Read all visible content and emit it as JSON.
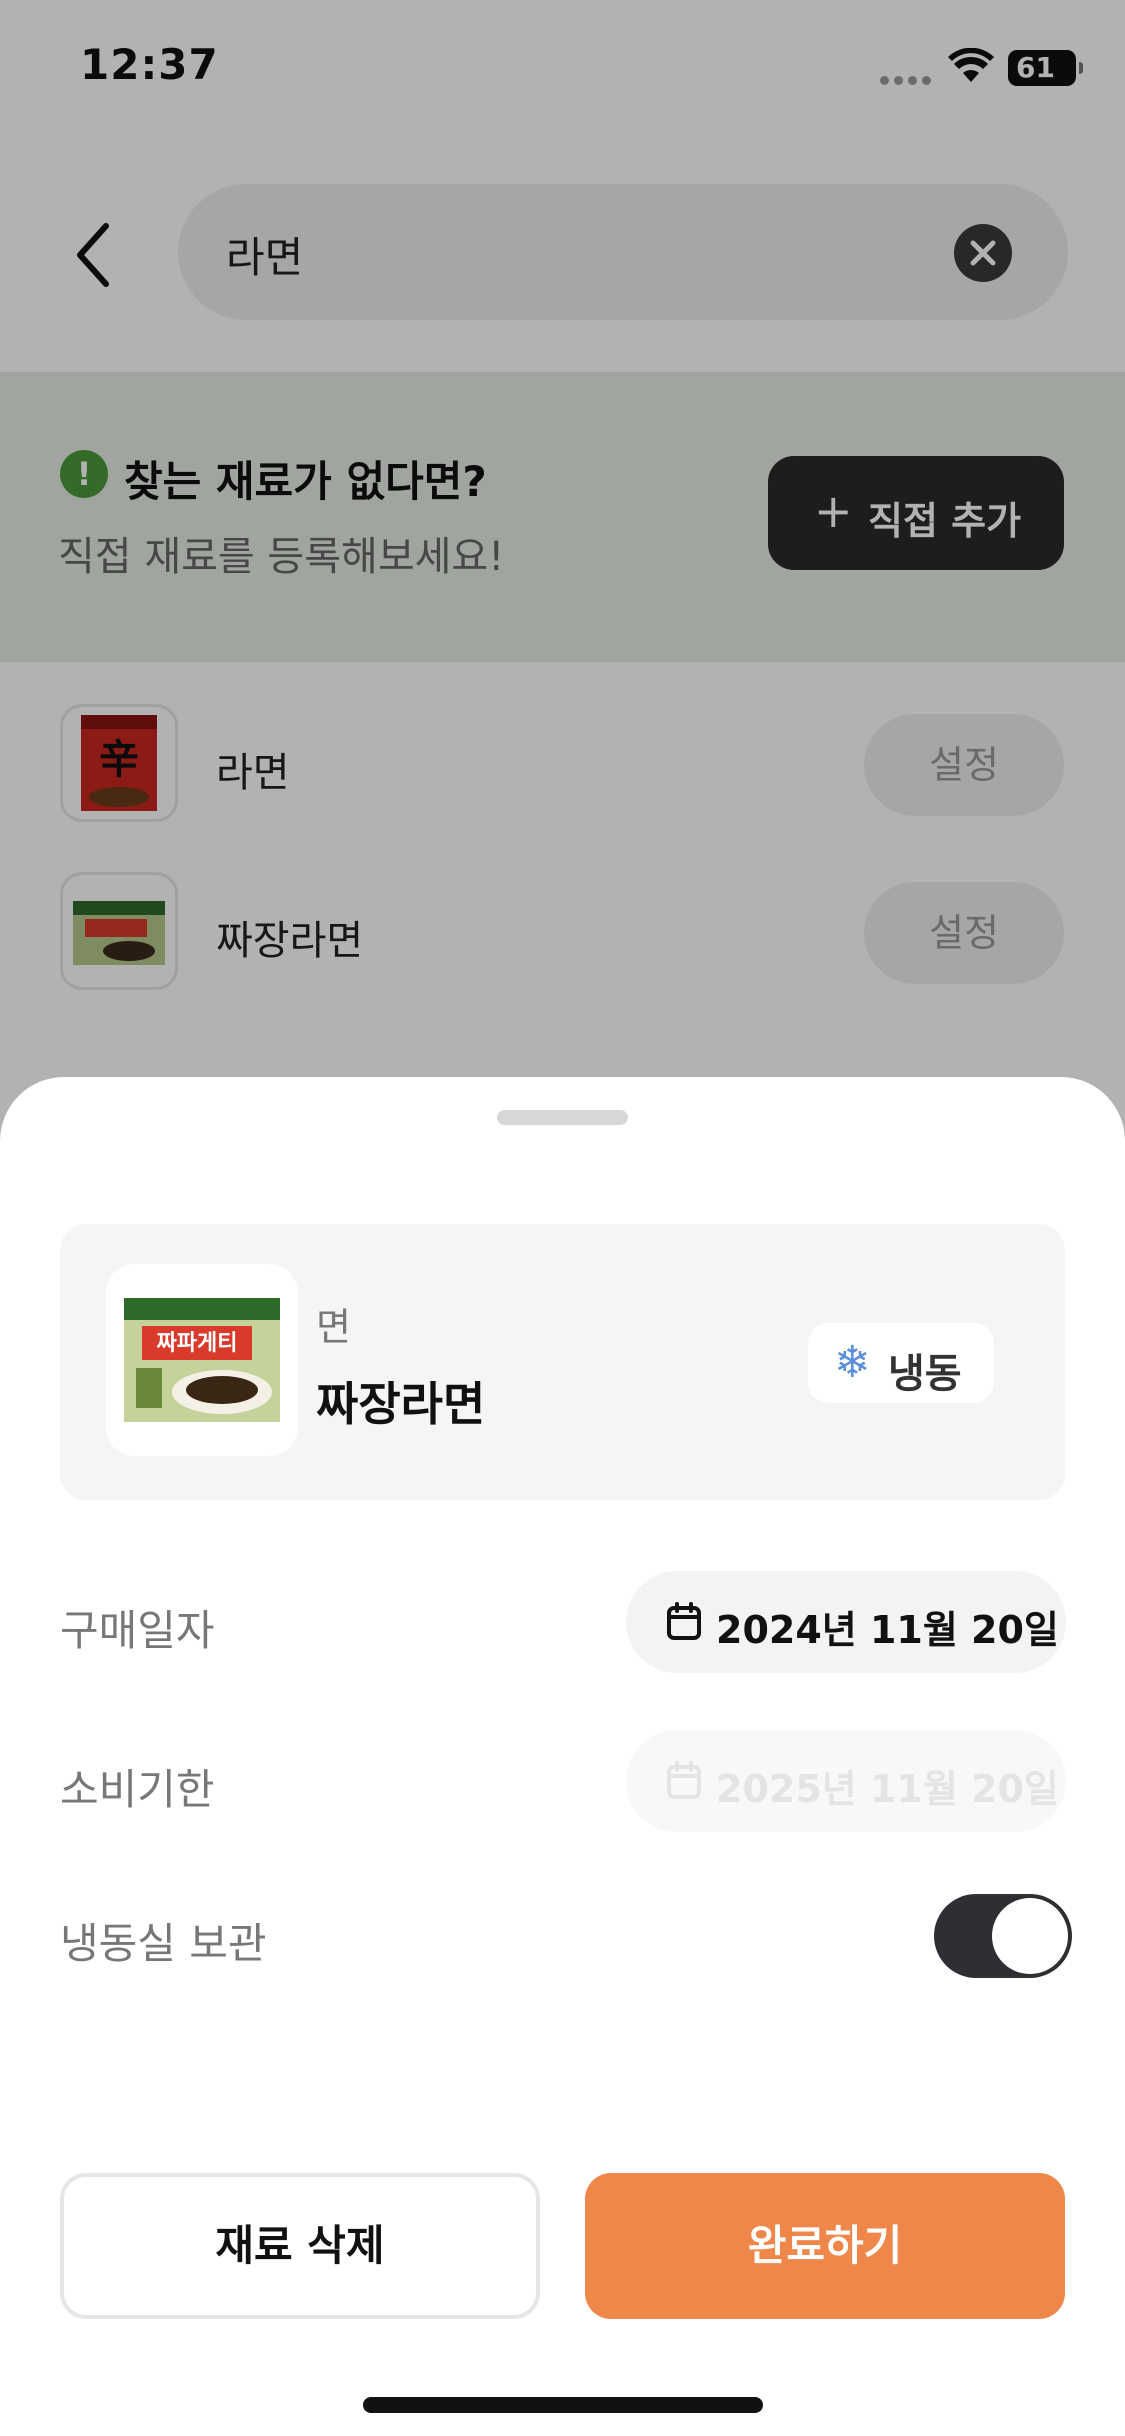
{
  "status_bar": {
    "time": "12:37",
    "battery": "61"
  },
  "search": {
    "query": "라면"
  },
  "banner": {
    "title": "찾는 재료가 없다면?",
    "subtitle": "직접 재료를 등록해보세요!",
    "add_button": "직접 추가"
  },
  "results": [
    {
      "name": "라면",
      "button": "설정"
    },
    {
      "name": "짜장라면",
      "button": "설정"
    }
  ],
  "sheet": {
    "category": "면",
    "name": "짜장라면",
    "storage_badge": "냉동",
    "purchase_label": "구매일자",
    "purchase_date": "2024년 11월 20일",
    "expiry_label": "소비기한",
    "expiry_date": "2025년 11월 20일",
    "freezer_label": "냉동실 보관",
    "freezer_on": true,
    "delete_button": "재료 삭제",
    "done_button": "완료하기"
  },
  "colors": {
    "accent": "#f0874a",
    "banner_bg": "#e7ede5",
    "banner_icon": "#4c9a3b",
    "freeze_icon": "#5b8fdc"
  }
}
